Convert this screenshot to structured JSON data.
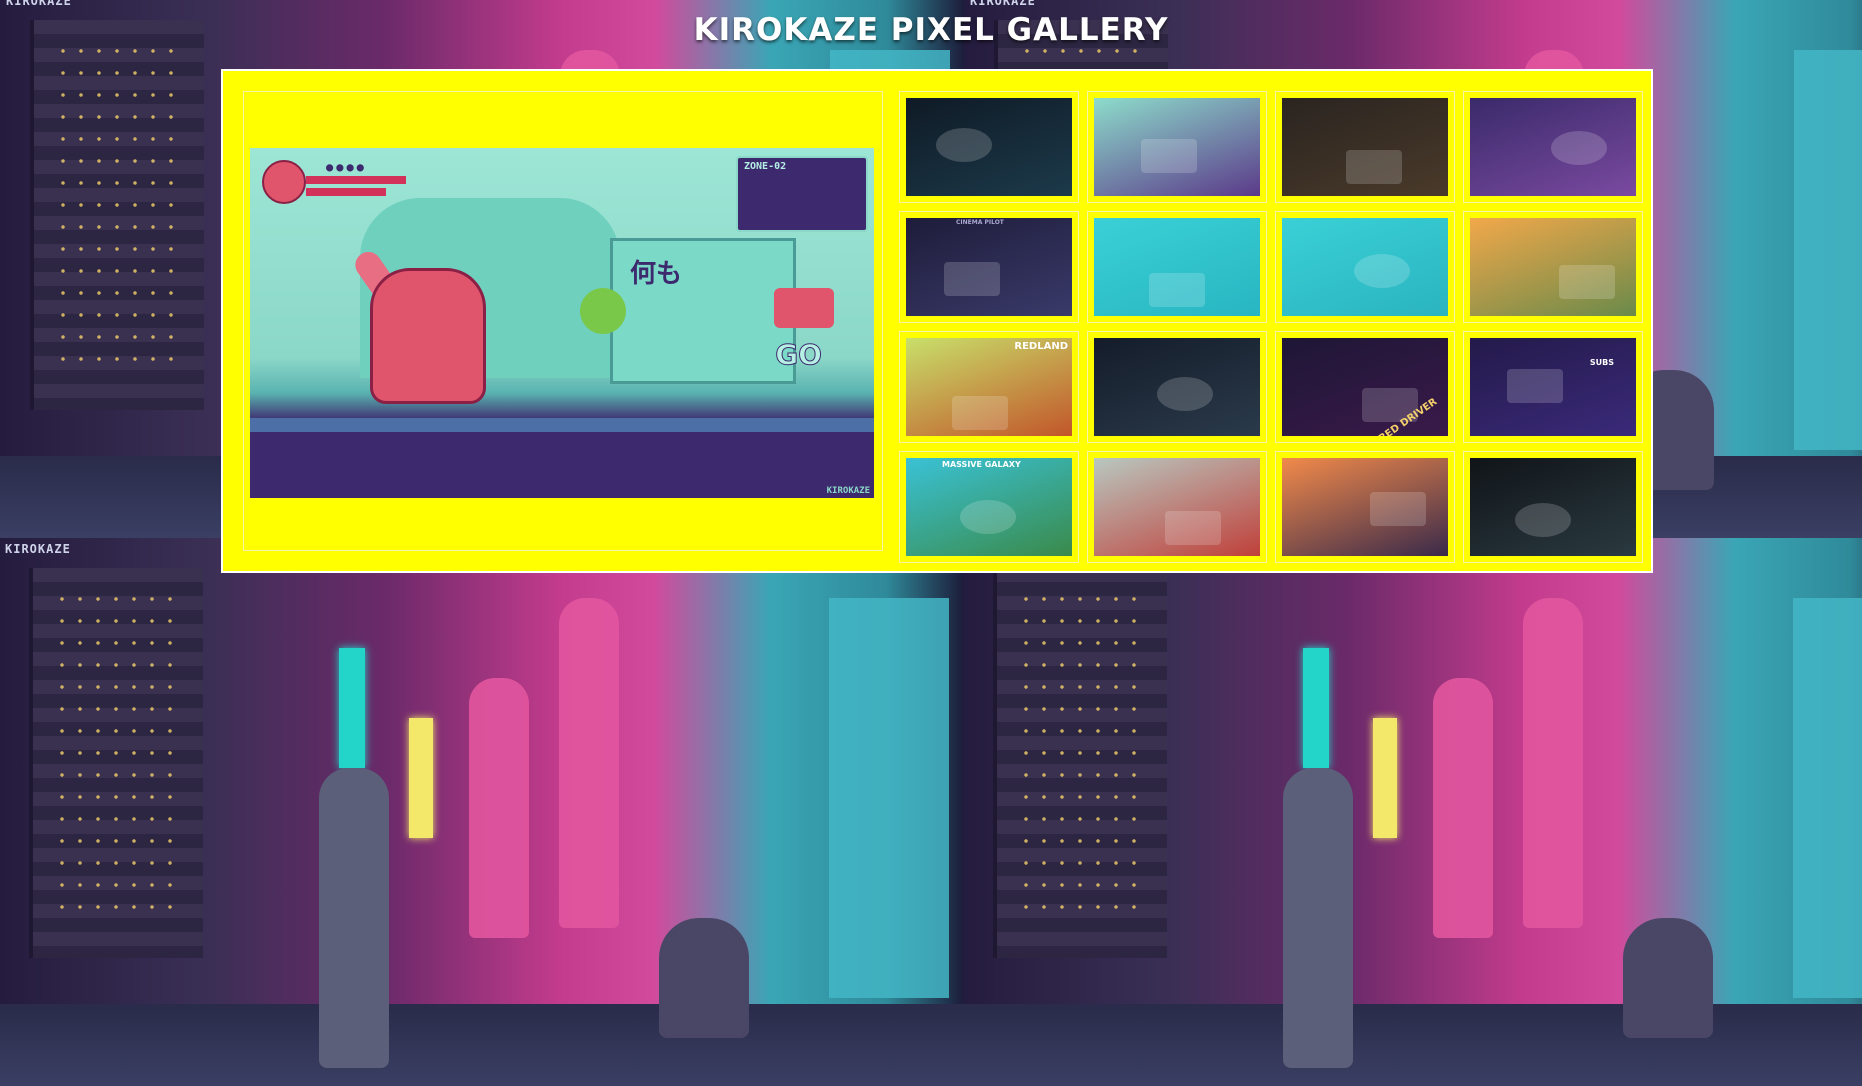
{
  "background": {
    "watermark": "KIROKAZE"
  },
  "header": {
    "title": "KIROKAZE PIXEL GALLERY"
  },
  "featured": {
    "hud_dots": "●●●●",
    "zone_label": "ZONE-02",
    "go_text": "GO",
    "kanji_text": "何も",
    "watermark": "KIROKAZE"
  },
  "thumbnails": [
    {
      "name": "thumb-motorcycle-night",
      "colors": [
        "#0f1a26",
        "#1c3a4a"
      ],
      "label": ""
    },
    {
      "name": "thumb-robot-bunny-city",
      "colors": [
        "#8ddccb",
        "#5b3a8a"
      ],
      "label": ""
    },
    {
      "name": "thumb-dark-mech-room",
      "colors": [
        "#2a2420",
        "#4a3a2a"
      ],
      "label": ""
    },
    {
      "name": "thumb-purple-space",
      "colors": [
        "#3a2a6a",
        "#7a4aa0"
      ],
      "label": ""
    },
    {
      "name": "thumb-cinema-pilot",
      "colors": [
        "#1e1c3a",
        "#3a3a6a"
      ],
      "label": "CINEMA PILOT"
    },
    {
      "name": "thumb-boat-water",
      "colors": [
        "#3ad0d6",
        "#28b6c2"
      ],
      "label": ""
    },
    {
      "name": "thumb-isometric-ship",
      "colors": [
        "#3ad0d6",
        "#2ab4c0"
      ],
      "label": ""
    },
    {
      "name": "thumb-sunset-robot",
      "colors": [
        "#f2a84a",
        "#6a8a4a"
      ],
      "label": ""
    },
    {
      "name": "thumb-redland",
      "colors": [
        "#c8e06a",
        "#c2562a"
      ],
      "label": "REDLAND"
    },
    {
      "name": "thumb-night-city-street",
      "colors": [
        "#141c2a",
        "#2a3a4a"
      ],
      "label": ""
    },
    {
      "name": "thumb-red-driver",
      "colors": [
        "#1e1636",
        "#3a1a4a"
      ],
      "label": "RED DRIVER"
    },
    {
      "name": "thumb-subs-robot",
      "colors": [
        "#241a4a",
        "#3a2a7a"
      ],
      "label": "SUBS"
    },
    {
      "name": "thumb-massive-galaxy",
      "colors": [
        "#3ac2d6",
        "#3a8a4a"
      ],
      "label": "MASSIVE GALAXY"
    },
    {
      "name": "thumb-mech-hangar",
      "colors": [
        "#b8c8c0",
        "#c0403a"
      ],
      "label": ""
    },
    {
      "name": "thumb-car-sunset",
      "colors": [
        "#f28a4a",
        "#3a2a4a"
      ],
      "label": ""
    },
    {
      "name": "thumb-dark-helmet",
      "colors": [
        "#101418",
        "#2a3a40"
      ],
      "label": ""
    }
  ],
  "colors": {
    "gallery_bg": "#ffff00",
    "gallery_border": "#ffffff",
    "title": "#ffffff"
  }
}
